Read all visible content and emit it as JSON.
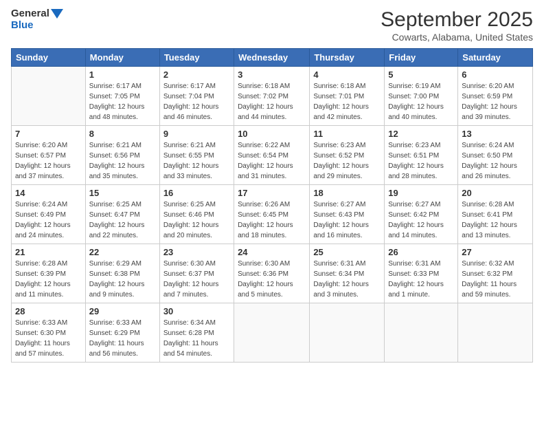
{
  "header": {
    "logo_line1": "General",
    "logo_line2": "Blue",
    "month_title": "September 2025",
    "location": "Cowarts, Alabama, United States"
  },
  "weekdays": [
    "Sunday",
    "Monday",
    "Tuesday",
    "Wednesday",
    "Thursday",
    "Friday",
    "Saturday"
  ],
  "weeks": [
    [
      {
        "day": "",
        "info": ""
      },
      {
        "day": "1",
        "info": "Sunrise: 6:17 AM\nSunset: 7:05 PM\nDaylight: 12 hours\nand 48 minutes."
      },
      {
        "day": "2",
        "info": "Sunrise: 6:17 AM\nSunset: 7:04 PM\nDaylight: 12 hours\nand 46 minutes."
      },
      {
        "day": "3",
        "info": "Sunrise: 6:18 AM\nSunset: 7:02 PM\nDaylight: 12 hours\nand 44 minutes."
      },
      {
        "day": "4",
        "info": "Sunrise: 6:18 AM\nSunset: 7:01 PM\nDaylight: 12 hours\nand 42 minutes."
      },
      {
        "day": "5",
        "info": "Sunrise: 6:19 AM\nSunset: 7:00 PM\nDaylight: 12 hours\nand 40 minutes."
      },
      {
        "day": "6",
        "info": "Sunrise: 6:20 AM\nSunset: 6:59 PM\nDaylight: 12 hours\nand 39 minutes."
      }
    ],
    [
      {
        "day": "7",
        "info": "Sunrise: 6:20 AM\nSunset: 6:57 PM\nDaylight: 12 hours\nand 37 minutes."
      },
      {
        "day": "8",
        "info": "Sunrise: 6:21 AM\nSunset: 6:56 PM\nDaylight: 12 hours\nand 35 minutes."
      },
      {
        "day": "9",
        "info": "Sunrise: 6:21 AM\nSunset: 6:55 PM\nDaylight: 12 hours\nand 33 minutes."
      },
      {
        "day": "10",
        "info": "Sunrise: 6:22 AM\nSunset: 6:54 PM\nDaylight: 12 hours\nand 31 minutes."
      },
      {
        "day": "11",
        "info": "Sunrise: 6:23 AM\nSunset: 6:52 PM\nDaylight: 12 hours\nand 29 minutes."
      },
      {
        "day": "12",
        "info": "Sunrise: 6:23 AM\nSunset: 6:51 PM\nDaylight: 12 hours\nand 28 minutes."
      },
      {
        "day": "13",
        "info": "Sunrise: 6:24 AM\nSunset: 6:50 PM\nDaylight: 12 hours\nand 26 minutes."
      }
    ],
    [
      {
        "day": "14",
        "info": "Sunrise: 6:24 AM\nSunset: 6:49 PM\nDaylight: 12 hours\nand 24 minutes."
      },
      {
        "day": "15",
        "info": "Sunrise: 6:25 AM\nSunset: 6:47 PM\nDaylight: 12 hours\nand 22 minutes."
      },
      {
        "day": "16",
        "info": "Sunrise: 6:25 AM\nSunset: 6:46 PM\nDaylight: 12 hours\nand 20 minutes."
      },
      {
        "day": "17",
        "info": "Sunrise: 6:26 AM\nSunset: 6:45 PM\nDaylight: 12 hours\nand 18 minutes."
      },
      {
        "day": "18",
        "info": "Sunrise: 6:27 AM\nSunset: 6:43 PM\nDaylight: 12 hours\nand 16 minutes."
      },
      {
        "day": "19",
        "info": "Sunrise: 6:27 AM\nSunset: 6:42 PM\nDaylight: 12 hours\nand 14 minutes."
      },
      {
        "day": "20",
        "info": "Sunrise: 6:28 AM\nSunset: 6:41 PM\nDaylight: 12 hours\nand 13 minutes."
      }
    ],
    [
      {
        "day": "21",
        "info": "Sunrise: 6:28 AM\nSunset: 6:39 PM\nDaylight: 12 hours\nand 11 minutes."
      },
      {
        "day": "22",
        "info": "Sunrise: 6:29 AM\nSunset: 6:38 PM\nDaylight: 12 hours\nand 9 minutes."
      },
      {
        "day": "23",
        "info": "Sunrise: 6:30 AM\nSunset: 6:37 PM\nDaylight: 12 hours\nand 7 minutes."
      },
      {
        "day": "24",
        "info": "Sunrise: 6:30 AM\nSunset: 6:36 PM\nDaylight: 12 hours\nand 5 minutes."
      },
      {
        "day": "25",
        "info": "Sunrise: 6:31 AM\nSunset: 6:34 PM\nDaylight: 12 hours\nand 3 minutes."
      },
      {
        "day": "26",
        "info": "Sunrise: 6:31 AM\nSunset: 6:33 PM\nDaylight: 12 hours\nand 1 minute."
      },
      {
        "day": "27",
        "info": "Sunrise: 6:32 AM\nSunset: 6:32 PM\nDaylight: 11 hours\nand 59 minutes."
      }
    ],
    [
      {
        "day": "28",
        "info": "Sunrise: 6:33 AM\nSunset: 6:30 PM\nDaylight: 11 hours\nand 57 minutes."
      },
      {
        "day": "29",
        "info": "Sunrise: 6:33 AM\nSunset: 6:29 PM\nDaylight: 11 hours\nand 56 minutes."
      },
      {
        "day": "30",
        "info": "Sunrise: 6:34 AM\nSunset: 6:28 PM\nDaylight: 11 hours\nand 54 minutes."
      },
      {
        "day": "",
        "info": ""
      },
      {
        "day": "",
        "info": ""
      },
      {
        "day": "",
        "info": ""
      },
      {
        "day": "",
        "info": ""
      }
    ]
  ]
}
